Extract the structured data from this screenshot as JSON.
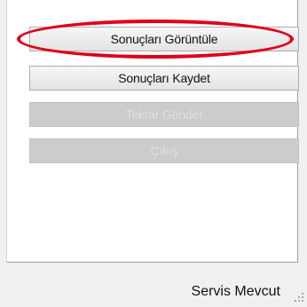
{
  "buttons": {
    "view_results": "Sonuçları Görüntüle",
    "save_results": "Sonuçları Kaydet",
    "resend": "Tekrar Gönder",
    "exit": "Çıkış"
  },
  "status": {
    "service": "Servis Mevcut"
  },
  "colors": {
    "highlight": "#e0001a",
    "disabled_button": "#cccccc"
  }
}
